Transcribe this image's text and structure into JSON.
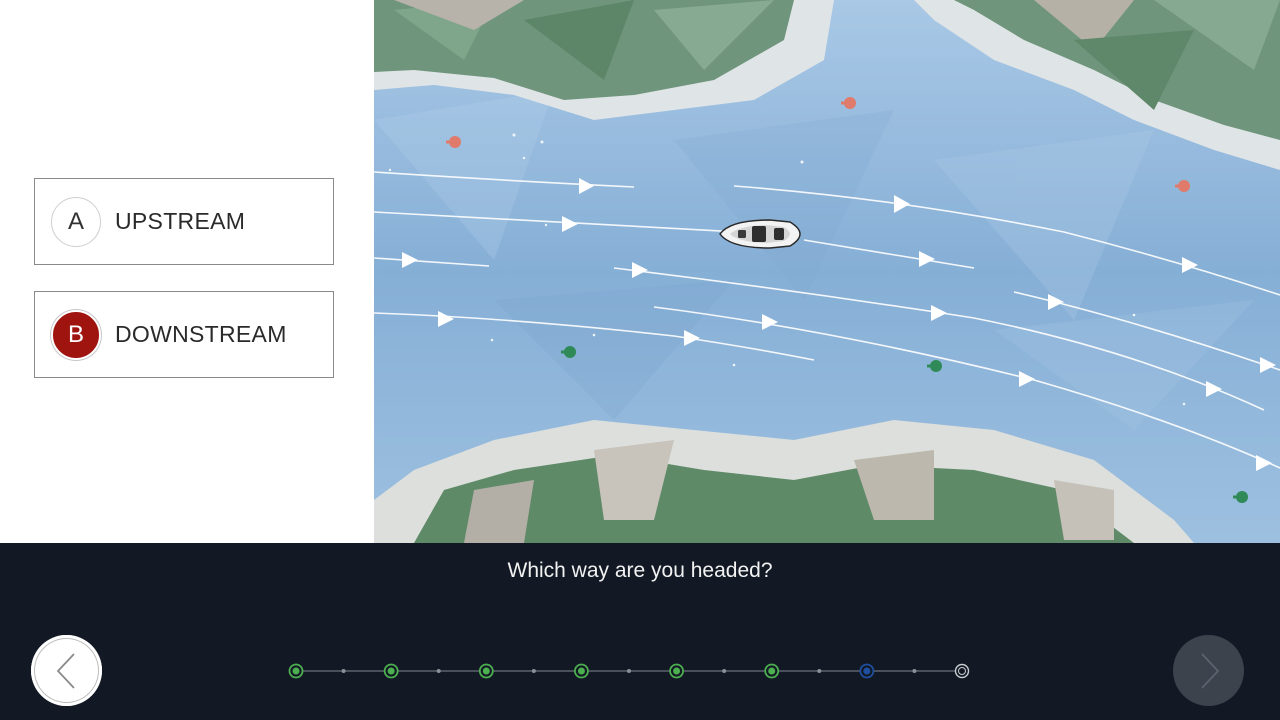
{
  "question": {
    "prompt": "Which way are you headed?"
  },
  "options": [
    {
      "letter": "A",
      "label": "UPSTREAM",
      "selected": false
    },
    {
      "letter": "B",
      "label": "DOWNSTREAM",
      "selected": true
    }
  ],
  "colors": {
    "selected_badge": "#a0140f",
    "bottom_bar": "#121924",
    "progress_done": "#4caf50",
    "progress_current": "#1f4fa0",
    "water": "#8fb6db",
    "red_buoy": "#e07a6a",
    "green_buoy": "#2f8a58"
  },
  "navigation": {
    "prev_icon": "chevron-left-icon",
    "next_icon": "chevron-right-icon",
    "next_enabled": false
  },
  "progress": {
    "total_steps": 8,
    "completed_steps": 6,
    "current_step": 7
  },
  "scene": {
    "boat_icon": "boat-icon",
    "current_direction": "left-to-right"
  }
}
